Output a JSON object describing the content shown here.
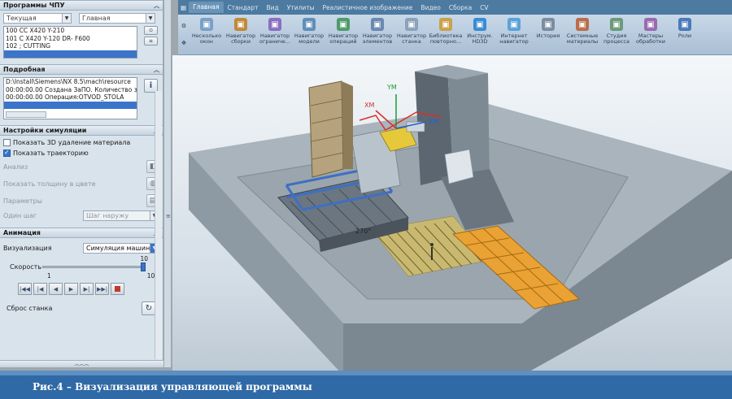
{
  "panel": {
    "nc_programs": {
      "title": "Программы ЧПУ",
      "current_label": "Текущая",
      "current_value": "Главная",
      "items": [
        "100 СС X420 Y-210",
        "101 С X420 Y-120 DR- F600",
        "102 ; CUTTING",
        ""
      ],
      "selected_index": 3
    },
    "detail": {
      "title": "Подробная",
      "items": [
        "D:\\Install\\Siemens\\NX 8.5\\mach\\resource",
        "00:00:00.00 Создана ЗаПО. Количество з",
        "00:00:00.00 Операция:OTVOD_STOLA",
        ""
      ],
      "selected_index": 3
    },
    "sim_settings": {
      "title": "Настройки симуляции",
      "show_3d_label": "Показать 3D удаление материала",
      "show_3d_checked": false,
      "show_path_label": "Показать траекторию",
      "show_path_checked": true,
      "analysis_label": "Анализ",
      "thickness_label": "Показать толщину в цвете",
      "params_label": "Параметры",
      "step_label": "Один шаг",
      "step_value": "Шаг наружу"
    },
    "animation": {
      "title": "Анимация",
      "viz_label": "Визуализация",
      "viz_value": "Симуляция машинн",
      "speed_label": "Скорость",
      "speed_value": "10",
      "speed_min": "1",
      "speed_max": "10",
      "reset_label": "Сброс станка"
    }
  },
  "ribbon": {
    "tabs": [
      "Главная",
      "Стандарт",
      "Вид",
      "Утилиты",
      "Реалистичное изображение",
      "Видео",
      "Сборка",
      "CV"
    ],
    "active_tab": 0,
    "buttons": [
      {
        "label": "Несколько окон",
        "color": "#7aa0c8"
      },
      {
        "label": "Навигатор сборки",
        "color": "#c08a3a"
      },
      {
        "label": "Навигатор ограниче...",
        "color": "#8a6ec0"
      },
      {
        "label": "Навигатор модели",
        "color": "#5f8fb8"
      },
      {
        "label": "Навигатор операций",
        "color": "#4f9a6a"
      },
      {
        "label": "Навигатор элементов",
        "color": "#6a88b0"
      },
      {
        "label": "Навигатор станка",
        "color": "#8aa2ba"
      },
      {
        "label": "Библиотека повторно...",
        "color": "#c9a14a"
      },
      {
        "label": "Инструм. HD3D",
        "color": "#3a8ad0"
      },
      {
        "label": "Интернет навигатор",
        "color": "#5aa2d8"
      },
      {
        "label": "История",
        "color": "#7a8ea2"
      },
      {
        "label": "Системные материалы",
        "color": "#b86e4a"
      },
      {
        "label": "Студия процесса",
        "color": "#6a9a7a"
      },
      {
        "label": "Мастеры обработки",
        "color": "#9a6ab0"
      },
      {
        "label": "Роли",
        "color": "#4a7ab8"
      }
    ]
  },
  "viewport": {
    "axis_y": "YM",
    "axis_z": "ZM",
    "axis_x": "XM",
    "table_marking": "270°"
  },
  "caption": "Рис.4 – Визуализация управляющей программы"
}
